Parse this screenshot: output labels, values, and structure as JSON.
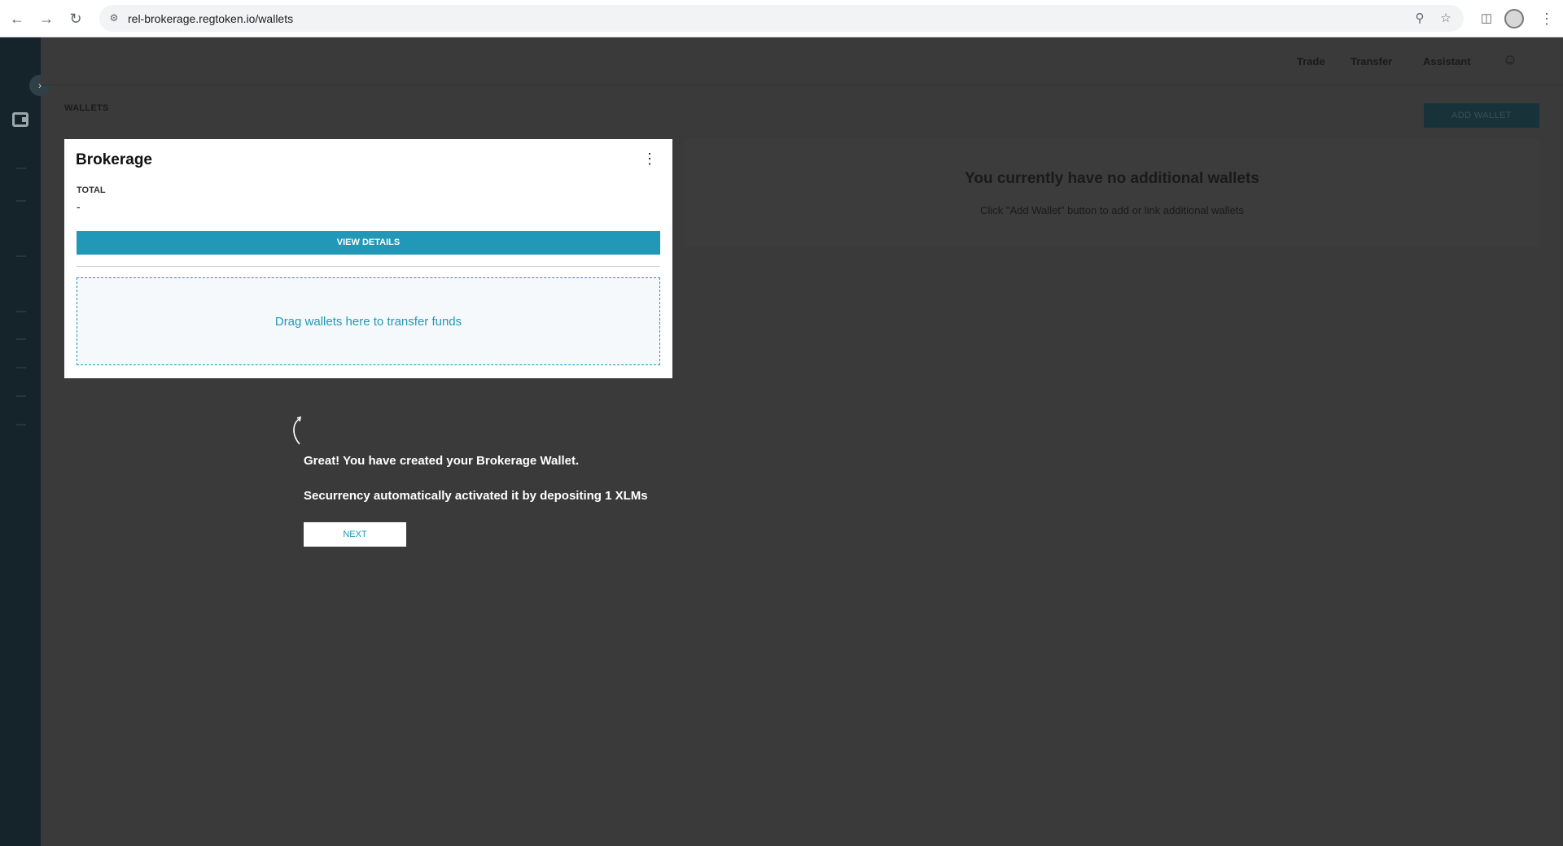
{
  "browser": {
    "url": "rel-brokerage.regtoken.io/wallets",
    "icons": [
      "back-icon",
      "forward-icon",
      "reload-icon",
      "site-settings-icon",
      "zoom-icon",
      "star-icon",
      "side-panel-icon",
      "profile-icon",
      "more-icon"
    ]
  },
  "sidebar": {
    "icons": [
      "expand-chevron-icon",
      "wallet-icon"
    ]
  },
  "topnav": {
    "items": [
      "Trade",
      "Transfer",
      "Assistant"
    ],
    "icon": "users-icon"
  },
  "page": {
    "breadcrumb": "WALLETS",
    "add_wallet_label": "ADD WALLET"
  },
  "wallet_card": {
    "name": "Brokerage",
    "total_label": "TOTAL",
    "total_value": "-",
    "view_details_label": "VIEW DETAILS",
    "dropzone_text": "Drag wallets here to transfer funds"
  },
  "empty_state": {
    "title": "You currently have no additional wallets",
    "subtitle": "Click \"Add Wallet\" button to add or link additional wallets"
  },
  "tour": {
    "line1": "Great! You have created your Brokerage Wallet.",
    "line2": "Securrency automatically activated it by depositing 1 XLMs",
    "next_label": "NEXT"
  },
  "colors": {
    "accent": "#2198b8",
    "overlay": "#3a3a3a",
    "rail": "#14242a"
  }
}
